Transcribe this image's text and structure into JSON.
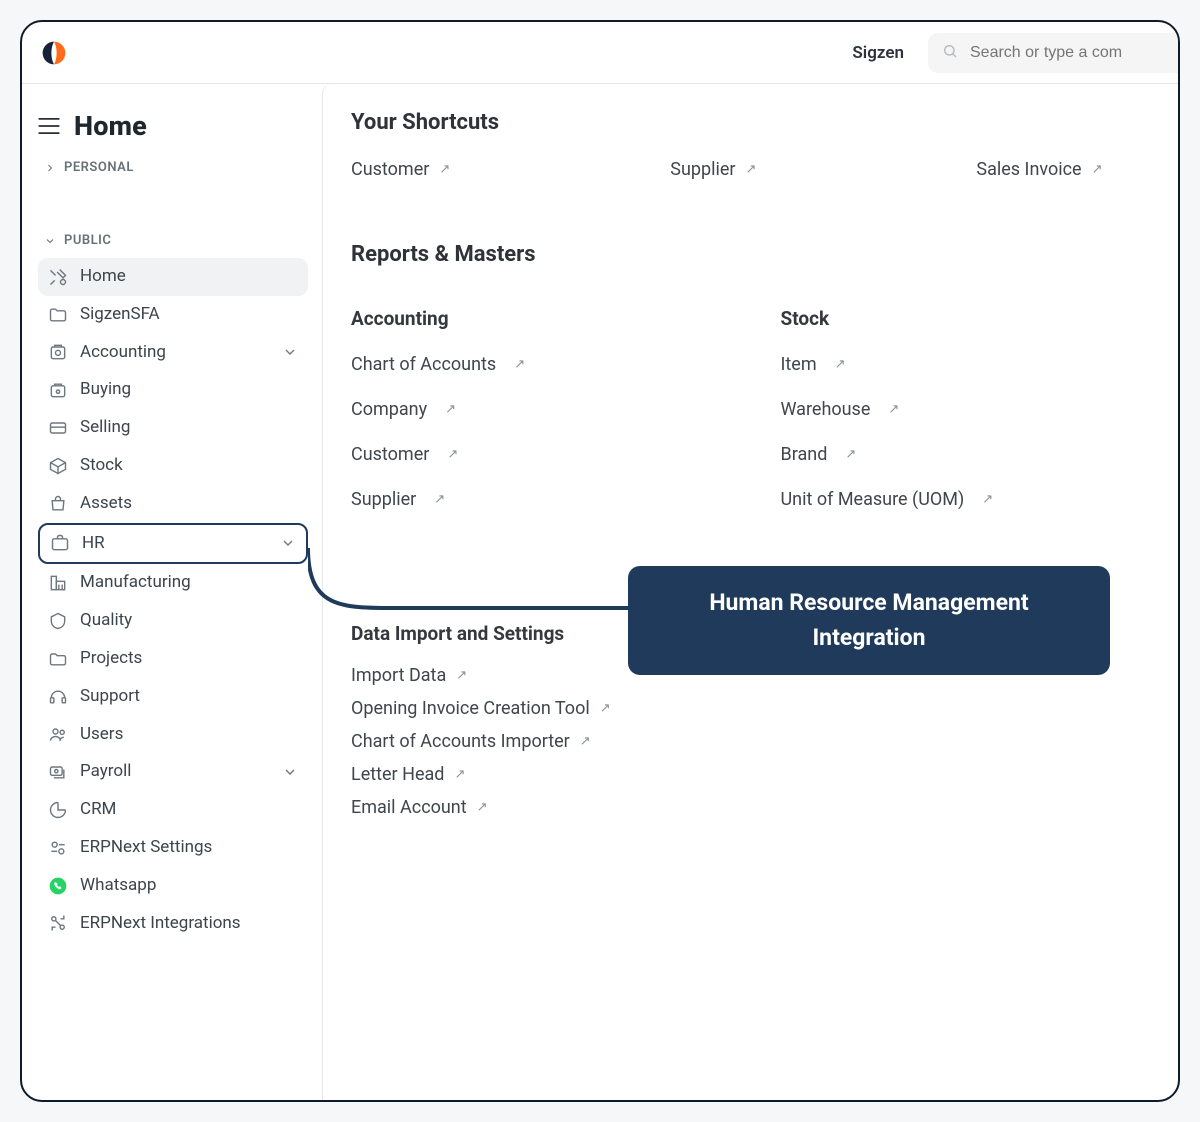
{
  "topbar": {
    "company": "Sigzen",
    "search_placeholder": "Search or type a com"
  },
  "page": {
    "title": "Home"
  },
  "sidebar": {
    "personal_label": "PERSONAL",
    "public_label": "PUBLIC",
    "items": [
      {
        "label": "Home",
        "has_chevron": false,
        "active": true
      },
      {
        "label": "SigzenSFA",
        "has_chevron": false
      },
      {
        "label": "Accounting",
        "has_chevron": true
      },
      {
        "label": "Buying",
        "has_chevron": false
      },
      {
        "label": "Selling",
        "has_chevron": false
      },
      {
        "label": "Stock",
        "has_chevron": false
      },
      {
        "label": "Assets",
        "has_chevron": false
      },
      {
        "label": "HR",
        "has_chevron": true,
        "highlight": true
      },
      {
        "label": "Manufacturing",
        "has_chevron": false
      },
      {
        "label": "Quality",
        "has_chevron": false
      },
      {
        "label": "Projects",
        "has_chevron": false
      },
      {
        "label": "Support",
        "has_chevron": false
      },
      {
        "label": "Users",
        "has_chevron": false
      },
      {
        "label": "Payroll",
        "has_chevron": true
      },
      {
        "label": "CRM",
        "has_chevron": false
      },
      {
        "label": "ERPNext Settings",
        "has_chevron": false
      },
      {
        "label": "Whatsapp",
        "has_chevron": false
      },
      {
        "label": "ERPNext Integrations",
        "has_chevron": false
      }
    ]
  },
  "main": {
    "shortcuts_title": "Your Shortcuts",
    "shortcuts": [
      {
        "label": "Customer"
      },
      {
        "label": "Supplier"
      },
      {
        "label": "Sales Invoice"
      }
    ],
    "reports_title": "Reports & Masters",
    "columns": [
      {
        "title": "Accounting",
        "items": [
          {
            "label": "Chart of Accounts"
          },
          {
            "label": "Company"
          },
          {
            "label": "Customer"
          },
          {
            "label": "Supplier"
          }
        ]
      },
      {
        "title": "Stock",
        "items": [
          {
            "label": "Item"
          },
          {
            "label": "Warehouse"
          },
          {
            "label": "Brand"
          },
          {
            "label": "Unit of Measure (UOM)"
          }
        ]
      }
    ],
    "import_title": "Data Import and Settings",
    "import_items": [
      {
        "label": "Import Data"
      },
      {
        "label": "Opening Invoice Creation Tool"
      },
      {
        "label": "Chart of Accounts Importer"
      },
      {
        "label": "Letter Head"
      },
      {
        "label": "Email Account"
      }
    ]
  },
  "callout": {
    "text": "Human Resource Management Integration"
  }
}
